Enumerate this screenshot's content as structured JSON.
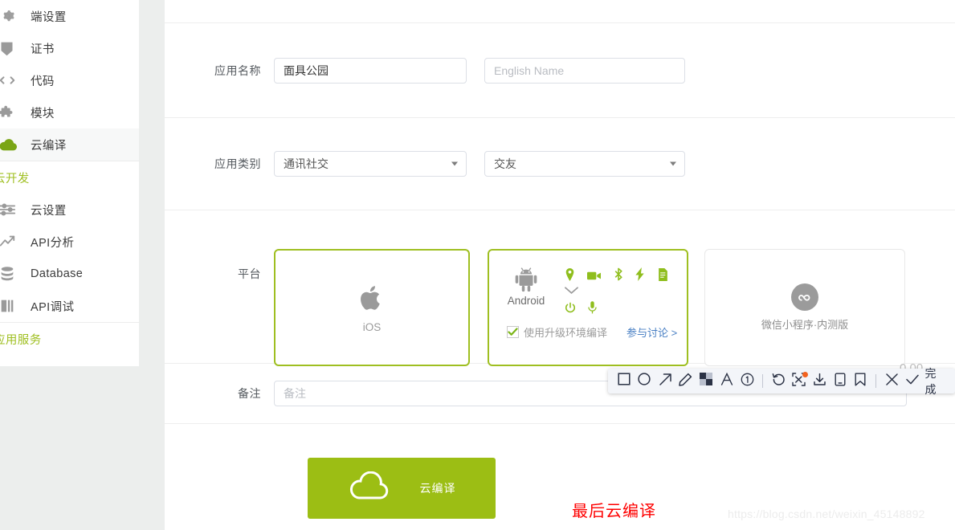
{
  "sidebar": {
    "items": [
      {
        "label": "端设置",
        "icon": "gear-icon",
        "active": false
      },
      {
        "label": "证书",
        "icon": "certificate-icon",
        "active": false
      },
      {
        "label": "代码",
        "icon": "code-icon",
        "active": false
      },
      {
        "label": "模块",
        "icon": "module-icon",
        "active": false
      },
      {
        "label": "云编译",
        "icon": "cloud-icon",
        "active": true
      }
    ],
    "group_cloud_label": "云开发",
    "cloud_items": [
      {
        "label": "云设置",
        "icon": "sliders-icon"
      },
      {
        "label": "API分析",
        "icon": "chart-line-icon"
      },
      {
        "label": "Database",
        "icon": "database-icon"
      },
      {
        "label": "API调试",
        "icon": "api-debug-icon"
      }
    ],
    "group_service_label": "应用服务"
  },
  "form": {
    "app_name": {
      "label": "应用名称",
      "value": "面具公园",
      "en_placeholder": "English Name",
      "en_value": ""
    },
    "app_category": {
      "label": "应用类别",
      "primary": "通讯社交",
      "secondary": "交友"
    },
    "platform": {
      "label": "平台",
      "ios": {
        "name": "iOS",
        "icon": "apple-icon",
        "selected": true
      },
      "android": {
        "name": "Android",
        "icon": "android-icon",
        "selected": true,
        "features": [
          "location-pin-icon",
          "video-camera-icon",
          "bluetooth-icon",
          "flash-icon",
          "document-icon",
          "chevron-down-icon",
          "power-icon",
          "microphone-icon"
        ],
        "checkbox_label": "使用升级环境编译",
        "checkbox_checked": true,
        "discuss_link": "参与讨论 >"
      },
      "wechat": {
        "name": "微信小程序·内测版",
        "icon": "wechat-miniprogram-icon",
        "selected": false
      }
    },
    "remark": {
      "label": "备注",
      "placeholder": "备注",
      "value": ""
    }
  },
  "compile_button": {
    "label": "云编译",
    "icon": "cloud-icon",
    "color": "#9cbe14"
  },
  "annotation": {
    "red_note": "最后云编译",
    "red_color": "#fe0000"
  },
  "watermark": {
    "text": "https://blog.csdn.net/weixin_45148892"
  },
  "toolbar": {
    "tools": [
      {
        "name": "rectangle-tool",
        "icon": "square-icon"
      },
      {
        "name": "ellipse-tool",
        "icon": "circle-icon"
      },
      {
        "name": "arrow-tool",
        "icon": "arrow-up-right-icon"
      },
      {
        "name": "pencil-tool",
        "icon": "pencil-icon"
      },
      {
        "name": "mosaic-tool",
        "icon": "mosaic-icon"
      },
      {
        "name": "text-tool",
        "icon": "letter-a-icon"
      },
      {
        "name": "number-tool",
        "icon": "circled-one-icon"
      }
    ],
    "actions": [
      {
        "name": "undo-button",
        "icon": "undo-icon",
        "badge": false
      },
      {
        "name": "ocr-button",
        "icon": "scan-text-icon",
        "badge": true
      },
      {
        "name": "download-button",
        "icon": "download-icon",
        "badge": false
      },
      {
        "name": "send-to-phone-button",
        "icon": "phone-icon",
        "badge": false
      },
      {
        "name": "pin-button",
        "icon": "bookmark-icon",
        "badge": false
      }
    ],
    "cancel_icon": "close-icon",
    "confirm_icon": "check-icon",
    "done_label": "完成"
  },
  "ghost_text": "0.00"
}
